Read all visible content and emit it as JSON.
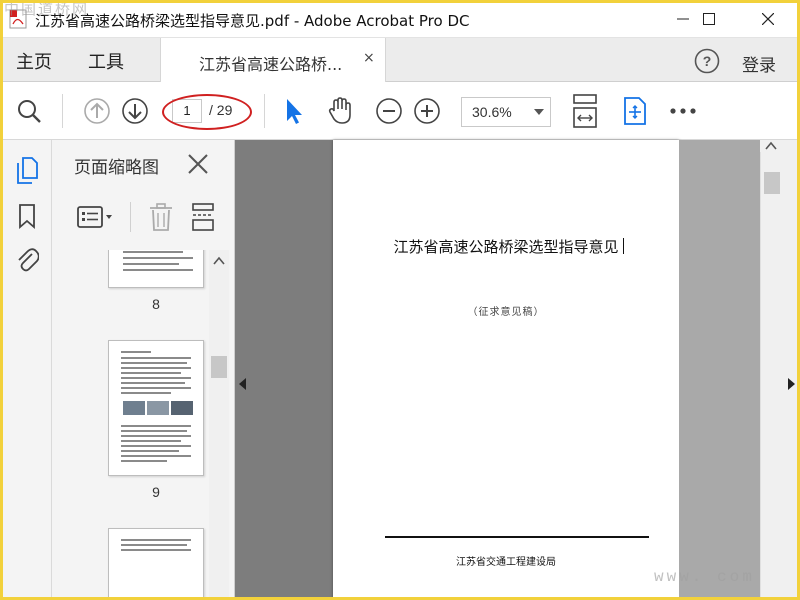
{
  "window": {
    "title": "江苏省高速公路桥梁选型指导意见.pdf - Adobe Acrobat Pro DC",
    "watermark_top": "中国道桥网",
    "watermark_bottom": "www.      com"
  },
  "tabs": {
    "home": "主页",
    "tools": "工具",
    "document_tab": "江苏省高速公路桥...",
    "close": "×",
    "login": "登录"
  },
  "toolbar": {
    "current_page": "1",
    "total_pages": "/ 29",
    "zoom": "30.6%",
    "icons": [
      "search-icon",
      "page-up-icon",
      "page-down-icon",
      "select-cursor-icon",
      "hand-icon",
      "zoom-out-icon",
      "zoom-in-icon",
      "fit-page-icon",
      "scrolling-mode-icon",
      "more-icon"
    ]
  },
  "sidebar": {
    "panel_title": "页面缩略图",
    "icons": [
      "page-thumbnails-icon",
      "bookmark-icon",
      "attachment-icon"
    ],
    "thumbnails": [
      {
        "page": "8"
      },
      {
        "page": "9"
      }
    ]
  },
  "document": {
    "title": "江苏省高速公路桥梁选型指导意见",
    "subtitle": "（征求意见稿）",
    "issuer": "江苏省交通工程建设局"
  },
  "colors": {
    "accent": "#1473e6",
    "highlight_ellipse": "#d02020",
    "frame": "#f2d13b",
    "viewport_bg": "#7d7d7d"
  }
}
